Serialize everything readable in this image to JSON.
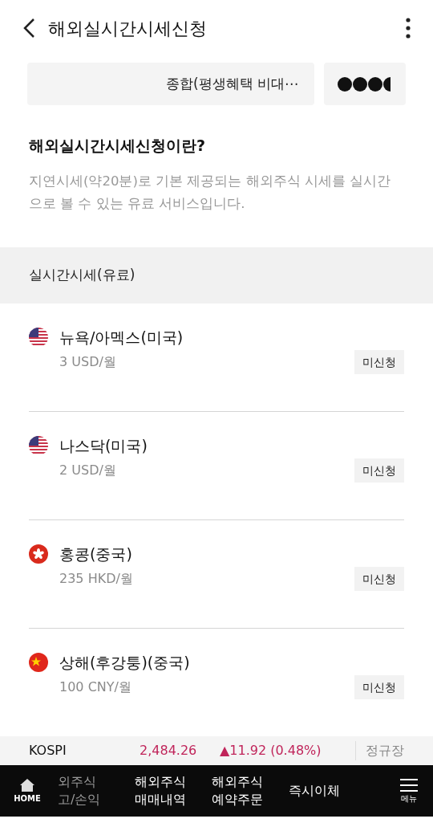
{
  "header": {
    "title": "해외실시간시세신청"
  },
  "account": {
    "name": "종합(평생혜택 비대⋯"
  },
  "intro": {
    "title": "해외실시간시세신청이란?",
    "description": "지연시세(약20분)로 기본 제공되는 해외주식 시세를 실시간으로 볼 수 있는 유료 서비스입니다."
  },
  "section": {
    "title": "실시간시세(유료)"
  },
  "markets": [
    {
      "kind": "us",
      "name": "뉴욕/아멕스(미국)",
      "price": "3 USD/월",
      "status": "미신청"
    },
    {
      "kind": "us",
      "name": "나스닥(미국)",
      "price": "2 USD/월",
      "status": "미신청"
    },
    {
      "kind": "hk",
      "name": "홍콩(중국)",
      "price": "235 HKD/월",
      "status": "미신청"
    },
    {
      "kind": "cn",
      "name": "상해(후강퉁)(중국)",
      "price": "100 CNY/월",
      "status": "미신청"
    }
  ],
  "ticker": {
    "index": "KOSPI",
    "value": "2,484.26",
    "change": "▲11.92 (0.48%)",
    "session": "정규장"
  },
  "bottom_nav": [
    {
      "kind": "home",
      "label": "HOME"
    },
    {
      "kind": "text",
      "lines": [
        "외주식",
        "고/손익"
      ],
      "faded": true
    },
    {
      "kind": "text",
      "lines": [
        "해외주식",
        "매매내역"
      ],
      "faded": false
    },
    {
      "kind": "text",
      "lines": [
        "해외주식",
        "예약주문"
      ],
      "faded": false
    },
    {
      "kind": "text",
      "lines": [
        "즉시이체"
      ],
      "faded": false
    },
    {
      "kind": "menu",
      "label": "메뉴"
    }
  ]
}
